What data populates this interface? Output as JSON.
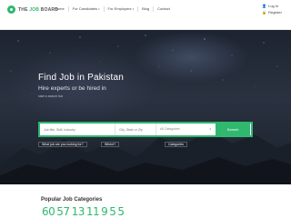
{
  "header": {
    "logo_prefix": "THE ",
    "logo_accent": "JOB",
    "logo_suffix": " BOARD",
    "nav": [
      "Home",
      "For Candidates",
      "For Employers",
      "Blog",
      "Contact"
    ],
    "login": "Log In",
    "register": "Register"
  },
  "hero": {
    "title": "Find Job in Pakistan",
    "subtitle": "Hire experts or be hired in",
    "tiny": "start a search bar",
    "what_label": "What job are you looking for?",
    "where_label": "Where?",
    "category_label": "Categories"
  },
  "search": {
    "keyword_placeholder": "Job title, Skill, Industry",
    "city_placeholder": "City, State or Zip",
    "category_value": "All Categories",
    "button": "Search"
  },
  "popular": {
    "title": "Popular Job Categories",
    "counts": [
      "60",
      "57",
      "13",
      "11",
      "9",
      "5",
      "5"
    ]
  },
  "colors": {
    "accent": "#2fb86e"
  }
}
